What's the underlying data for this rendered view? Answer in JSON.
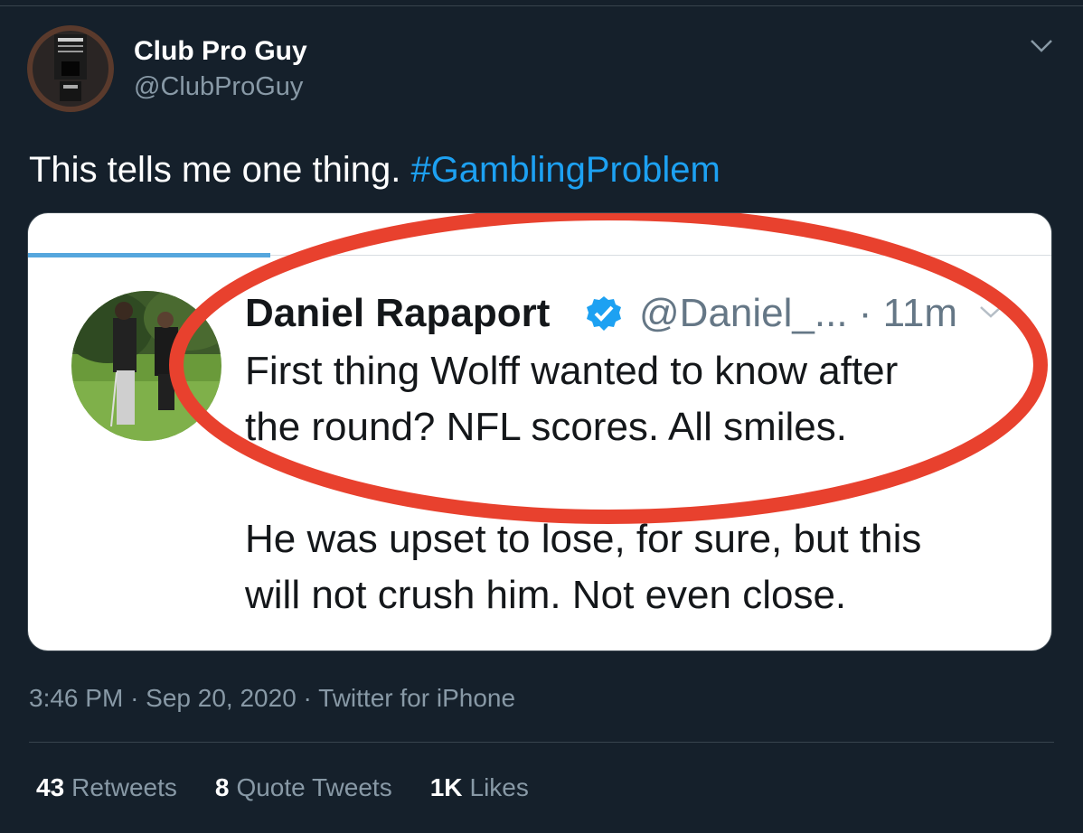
{
  "author": {
    "display_name": "Club Pro Guy",
    "handle": "@ClubProGuy"
  },
  "tweet": {
    "text": "This tells me one thing.",
    "hashtag": "#GamblingProblem"
  },
  "embedded_screenshot": {
    "author_name": "Daniel Rapaport",
    "author_handle": "@Daniel_...",
    "time_ago": "· 11m",
    "line1": "First thing Wolff wanted to know after",
    "line2": "the round? NFL scores. All smiles.",
    "line3": "He was upset to lose, for sure, but this",
    "line4": "will not crush him. Not even close.",
    "highlight_color": "#e8412e"
  },
  "meta": {
    "time": "3:46 PM",
    "separator": "·",
    "date": "Sep 20, 2020",
    "source": "Twitter for iPhone"
  },
  "stats": {
    "retweets_count": "43",
    "retweets_label": "Retweets",
    "quotes_count": "8",
    "quotes_label": "Quote Tweets",
    "likes_count": "1K",
    "likes_label": "Likes"
  },
  "colors": {
    "background": "#15202b",
    "link": "#1da1f2",
    "secondary_text": "#8899a6"
  },
  "icons": {
    "menu": "chevron-down-icon",
    "verified": "verified-badge-icon"
  }
}
